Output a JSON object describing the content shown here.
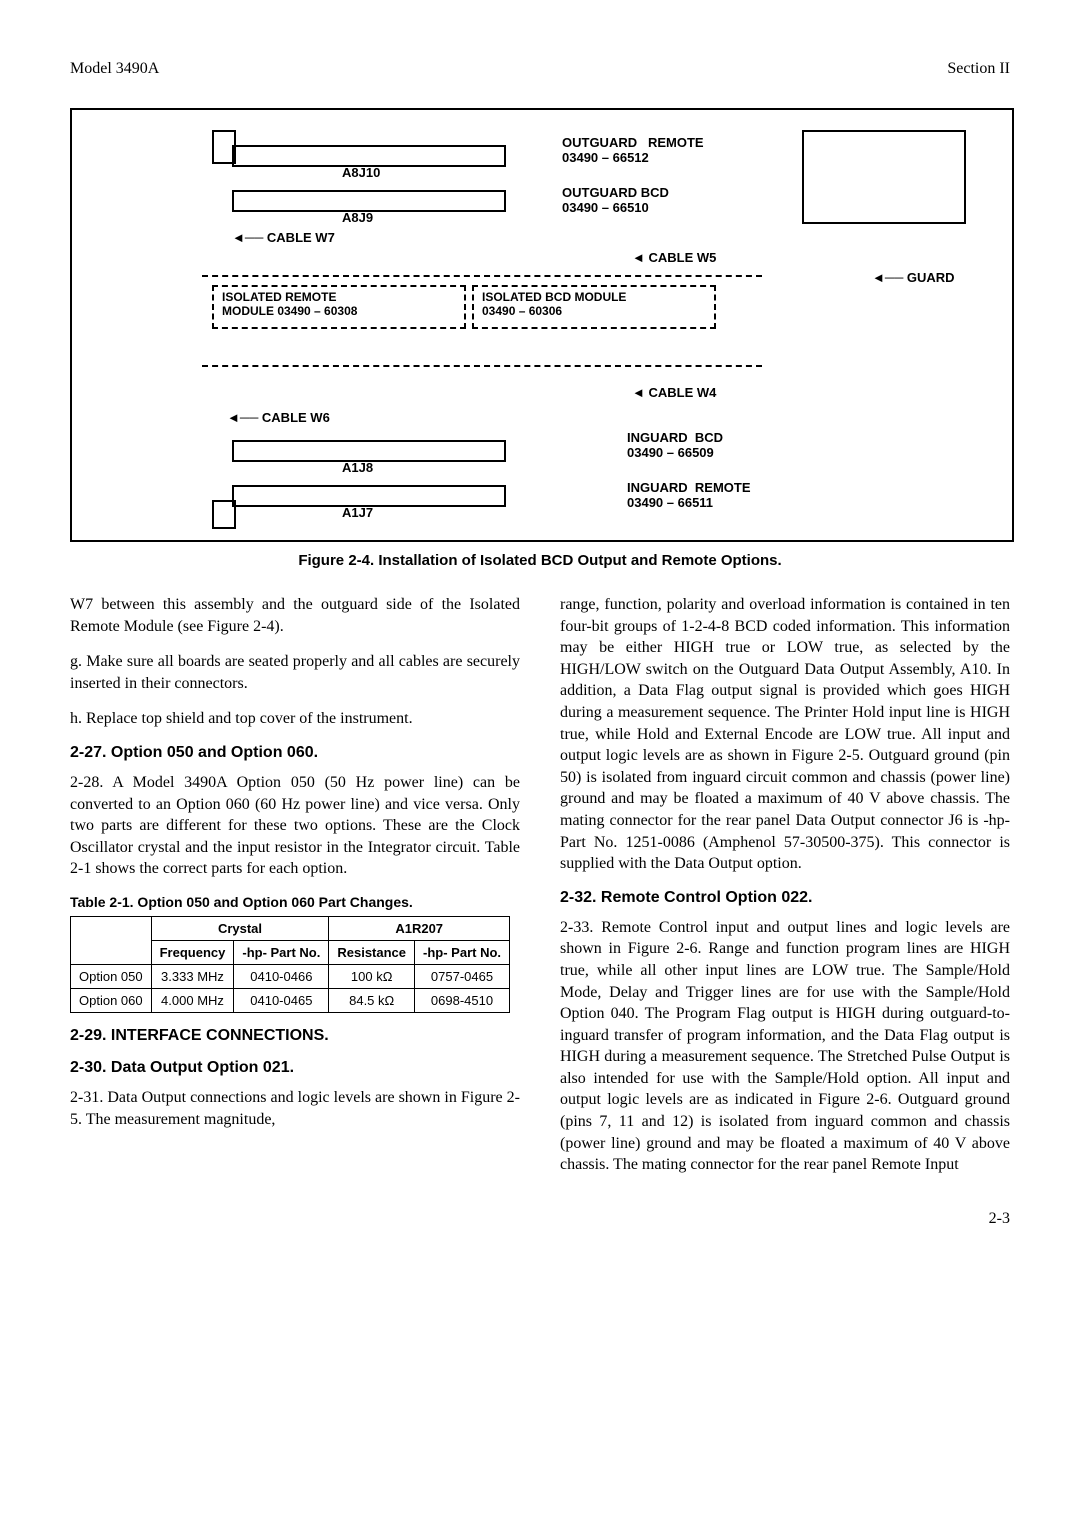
{
  "header": {
    "left": "Model 3490A",
    "right": "Section II"
  },
  "figure": {
    "labels": {
      "a8j10": "A8J10",
      "a8j9": "A8J9",
      "a1j8": "A1J8",
      "a1j7": "A1J7",
      "cable_w7": "CABLE  W7",
      "cable_w5": "CABLE W5",
      "cable_w4": "CABLE  W4",
      "cable_w6": "CABLE W6",
      "guard": "GUARD",
      "outguard_remote": "OUTGUARD   REMOTE\n03490 – 66512",
      "outguard_bcd": "OUTGUARD BCD\n03490 – 66510",
      "isolated_remote": "ISOLATED REMOTE\nMODULE 03490 – 60308",
      "isolated_bcd": "ISOLATED BCD MODULE\n03490 – 60306",
      "inguard_bcd": "INGUARD  BCD\n03490 – 66509",
      "inguard_remote": "INGUARD  REMOTE\n03490 – 66511"
    },
    "caption": "Figure 2-4.  Installation of Isolated BCD Output and Remote Options."
  },
  "left_col": {
    "p1": "W7 between this assembly and the outguard side of the Isolated Remote Module (see Figure 2-4).",
    "p2": "g.  Make sure all boards are seated properly and all cables are securely inserted in their connectors.",
    "p3": "h.  Replace top shield and top cover of the instrument.",
    "h1": "2-27.  Option 050 and Option 060.",
    "p4": "2-28. A Model 3490A Option 050 (50 Hz power line) can be converted to an Option 060 (60 Hz power line) and vice versa. Only two parts are different for these two options. These are the Clock Oscillator crystal and the input resistor in the Integrator circuit. Table 2-1 shows the correct parts for each option.",
    "table_caption": "Table 2-1.  Option 050 and Option 060 Part Changes.",
    "h2": "2-29.  INTERFACE CONNECTIONS.",
    "h3": "2-30.  Data Output Option 021.",
    "p5": "2-31. Data Output connections and logic levels are shown in Figure 2-5. The measurement magnitude,"
  },
  "table": {
    "headers": {
      "crystal": "Crystal",
      "a1r207": "A1R207",
      "freq": "Frequency",
      "hp1": "-hp- Part No.",
      "res": "Resistance",
      "hp2": "-hp- Part No."
    },
    "rows": [
      {
        "opt": "Option 050",
        "freq": "3.333 MHz",
        "hp1": "0410-0466",
        "res": "100 kΩ",
        "hp2": "0757-0465"
      },
      {
        "opt": "Option 060",
        "freq": "4.000 MHz",
        "hp1": "0410-0465",
        "res": "84.5 kΩ",
        "hp2": "0698-4510"
      }
    ]
  },
  "right_col": {
    "p1": "range, function, polarity and overload information is contained in ten four-bit groups of 1-2-4-8 BCD coded information. This information may be either HIGH true or LOW true, as selected by the HIGH/LOW switch on the Outguard Data Output Assembly, A10. In addition, a Data Flag output signal is provided which goes HIGH during a measurement sequence. The Printer Hold input line is HIGH true, while Hold and External Encode are LOW true. All input and output logic levels are as shown in Figure 2-5. Outguard ground (pin 50) is isolated from inguard circuit common and chassis (power line) ground and may be floated a maximum of 40 V above chassis. The mating connector for the rear panel Data Output connector J6 is -hp- Part No. 1251-0086 (Amphenol 57-30500-375). This connector is supplied with the Data Output option.",
    "h1": "2-32.  Remote Control Option 022.",
    "p2": "2-33. Remote Control input and output lines and logic levels are shown in Figure 2-6. Range and function program lines are HIGH true, while all other input lines are LOW true. The Sample/Hold Mode, Delay and Trigger lines are for use with the Sample/Hold Option 040. The Program Flag output is HIGH during outguard-to-inguard transfer of program information, and the Data Flag output is HIGH during a measurement sequence. The Stretched Pulse Output is also intended for use with the Sample/Hold option. All input and output logic levels are as indicated in Figure 2-6. Outguard ground (pins 7, 11 and 12) is isolated from inguard common and chassis (power line) ground and may be floated a maximum of 40 V above chassis. The mating connector for the rear panel Remote Input"
  },
  "page_num": "2-3"
}
